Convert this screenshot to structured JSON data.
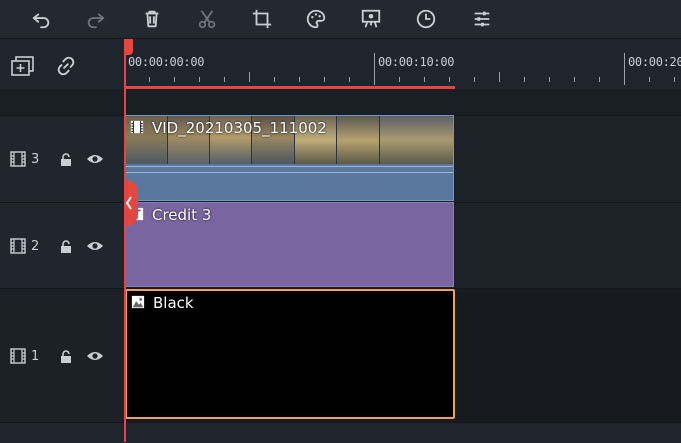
{
  "toolbar": {
    "icons": [
      "undo-icon",
      "redo-icon",
      "delete-icon",
      "cut-icon",
      "crop-icon",
      "color-icon",
      "screen-record-icon",
      "speed-icon",
      "adjust-icon"
    ]
  },
  "timeline": {
    "timecodes": [
      "00:00:00:00",
      "00:00:10:00",
      "00:00:20"
    ]
  },
  "tracks": [
    {
      "number": "3",
      "clip_label": "VID_20210305_111002",
      "clip_type": "video"
    },
    {
      "number": "2",
      "clip_label": "Credit 3",
      "clip_type": "title"
    },
    {
      "number": "1",
      "clip_label": "Black",
      "clip_type": "image"
    }
  ],
  "colors": {
    "accent": "#e4473f",
    "video_clip": "#5a77a0",
    "title_clip": "#7966a0",
    "image_clip": "#000000",
    "selected_border": "#f0a060"
  }
}
